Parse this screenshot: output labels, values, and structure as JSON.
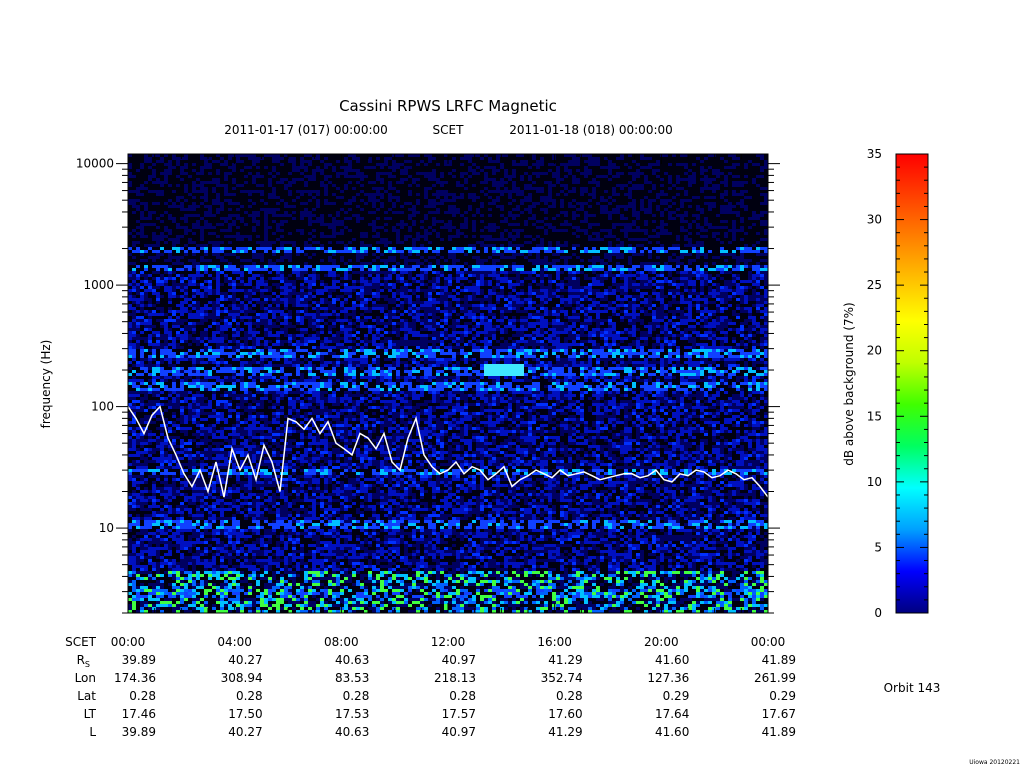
{
  "chart_data": {
    "type": "heatmap",
    "title": "Cassini RPWS LRFC Magnetic",
    "subtitle": {
      "start": "2011-01-17 (017) 00:00:00",
      "frame": "SCET",
      "end": "2011-01-18 (018) 00:00:00"
    },
    "ylabel": "frequency (Hz)",
    "yscale": "log",
    "ylim": [
      2,
      12000
    ],
    "yticks": [
      {
        "value": 10,
        "label": "10"
      },
      {
        "value": 100,
        "label": "100"
      },
      {
        "value": 1000,
        "label": "1000"
      },
      {
        "value": 10000,
        "label": "10000"
      }
    ],
    "xticks": [
      "00:00",
      "04:00",
      "08:00",
      "12:00",
      "16:00",
      "20:00",
      "00:00"
    ],
    "x_hours": [
      0,
      4,
      8,
      12,
      16,
      20,
      24
    ],
    "colorbar": {
      "label": "dB above background (7%)",
      "range": [
        0,
        35
      ],
      "ticks": [
        "0",
        "5",
        "10",
        "15",
        "20",
        "25",
        "30",
        "35"
      ],
      "colors": [
        "#000080",
        "#0000ff",
        "#00a0ff",
        "#00ffff",
        "#00ff60",
        "#40ff00",
        "#c0ff00",
        "#ffff00",
        "#ffc000",
        "#ff8000",
        "#ff4000",
        "#ff0000"
      ]
    },
    "background_level_colors": [
      "#000010",
      "#000060",
      "#0010c0",
      "#0030ff"
    ],
    "bands": [
      {
        "freq": 2000,
        "level": 8
      },
      {
        "freq": 1400,
        "level": 9
      },
      {
        "freq": 280,
        "level": 8
      },
      {
        "freq": 200,
        "level": 10
      },
      {
        "freq": 150,
        "level": 7
      },
      {
        "freq": 30,
        "level": 8
      },
      {
        "freq": 11,
        "level": 7
      },
      {
        "freq": 3,
        "level": 12
      }
    ],
    "highlight": {
      "x_hour": 14,
      "freq": 210,
      "level": 13
    },
    "cyclotron_line": {
      "color": "#ffffff",
      "x_hours": [
        0,
        0.3,
        0.6,
        0.9,
        1.2,
        1.5,
        1.8,
        2.1,
        2.4,
        2.7,
        3.0,
        3.3,
        3.6,
        3.9,
        4.2,
        4.5,
        4.8,
        5.1,
        5.4,
        5.7,
        6.0,
        6.3,
        6.6,
        6.9,
        7.2,
        7.5,
        7.8,
        8.1,
        8.4,
        8.7,
        9.0,
        9.3,
        9.6,
        9.9,
        10.2,
        10.5,
        10.8,
        11.1,
        11.4,
        11.7,
        12.0,
        12.3,
        12.6,
        12.9,
        13.2,
        13.5,
        13.8,
        14.1,
        14.4,
        14.7,
        15.0,
        15.3,
        15.6,
        15.9,
        16.2,
        16.5,
        16.8,
        17.1,
        17.4,
        17.7,
        18.0,
        18.3,
        18.6,
        18.9,
        19.2,
        19.5,
        19.8,
        20.1,
        20.4,
        20.7,
        21.0,
        21.3,
        21.6,
        21.9,
        22.2,
        22.5,
        22.8,
        23.1,
        23.4,
        23.7,
        24.0
      ],
      "freq_hz": [
        100,
        80,
        60,
        85,
        100,
        55,
        40,
        28,
        22,
        30,
        20,
        35,
        18,
        45,
        30,
        40,
        25,
        48,
        35,
        20,
        80,
        75,
        65,
        80,
        60,
        75,
        50,
        45,
        40,
        60,
        55,
        45,
        60,
        35,
        30,
        55,
        80,
        40,
        32,
        28,
        30,
        35,
        28,
        32,
        30,
        25,
        28,
        32,
        22,
        25,
        27,
        30,
        28,
        26,
        30,
        27,
        28,
        29,
        27,
        25,
        26,
        27,
        28,
        28,
        26,
        27,
        30,
        25,
        24,
        28,
        27,
        30,
        29,
        26,
        27,
        30,
        28,
        25,
        26,
        22,
        18
      ]
    }
  },
  "ephemeris": {
    "rows": [
      {
        "label": "SCET",
        "sub": "",
        "values": [
          "00:00",
          "04:00",
          "08:00",
          "12:00",
          "16:00",
          "20:00",
          "00:00"
        ]
      },
      {
        "label": "R",
        "sub": "S",
        "values": [
          "39.89",
          "40.27",
          "40.63",
          "40.97",
          "41.29",
          "41.60",
          "41.89"
        ]
      },
      {
        "label": "Lon",
        "sub": "",
        "values": [
          "174.36",
          "308.94",
          "83.53",
          "218.13",
          "352.74",
          "127.36",
          "261.99"
        ]
      },
      {
        "label": "Lat",
        "sub": "",
        "values": [
          "0.28",
          "0.28",
          "0.28",
          "0.28",
          "0.28",
          "0.29",
          "0.29"
        ]
      },
      {
        "label": "LT",
        "sub": "",
        "values": [
          "17.46",
          "17.50",
          "17.53",
          "17.57",
          "17.60",
          "17.64",
          "17.67"
        ]
      },
      {
        "label": "L",
        "sub": "",
        "values": [
          "39.89",
          "40.27",
          "40.63",
          "40.97",
          "41.29",
          "41.60",
          "41.89"
        ]
      }
    ]
  },
  "orbit_label": "Orbit 143",
  "footer": "Uiowa 20120221"
}
